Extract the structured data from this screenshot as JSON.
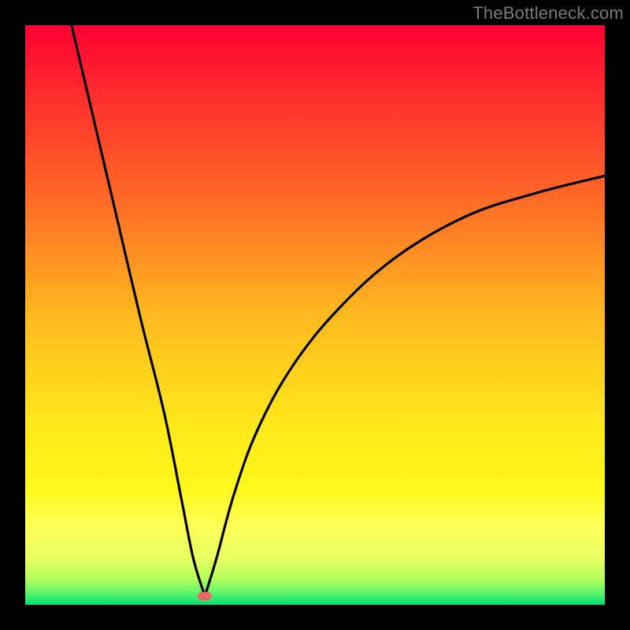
{
  "watermark": "TheBottleneck.com",
  "colors": {
    "frame_border": "#000000",
    "marker": "#e96a63",
    "curve_stroke": "#000000"
  },
  "gradient": {
    "stops": [
      {
        "pct": 0,
        "color": "#ff0033"
      },
      {
        "pct": 12,
        "color": "#ff2d2d"
      },
      {
        "pct": 30,
        "color": "#ff6a26"
      },
      {
        "pct": 50,
        "color": "#ffb91f"
      },
      {
        "pct": 68,
        "color": "#ffe61a"
      },
      {
        "pct": 80,
        "color": "#fff81a"
      },
      {
        "pct": 86.5,
        "color": "#feff57"
      },
      {
        "pct": 92,
        "color": "#e7ff60"
      },
      {
        "pct": 95.5,
        "color": "#b3ff5e"
      },
      {
        "pct": 97.5,
        "color": "#70f768"
      },
      {
        "pct": 100,
        "color": "#00e173"
      }
    ]
  },
  "chart_data": {
    "type": "line",
    "title": "",
    "xlabel": "",
    "ylabel": "",
    "xlim": [
      0,
      100
    ],
    "ylim": [
      0,
      100
    ],
    "note": "V-shaped bottleneck curve; minimum near x≈31. Left branch descends almost linearly from top-left corner to minimum; right branch rises with decreasing slope toward upper-right.",
    "minimum_x": 31,
    "minimum_y": 1.5,
    "left_branch_start": {
      "x": 8,
      "y": 100
    },
    "right_branch_end": {
      "x": 100,
      "y": 74
    },
    "series": [
      {
        "name": "bottleneck-curve",
        "points": [
          {
            "x": 8,
            "y": 100
          },
          {
            "x": 12,
            "y": 83
          },
          {
            "x": 16,
            "y": 66
          },
          {
            "x": 20,
            "y": 49
          },
          {
            "x": 24,
            "y": 33
          },
          {
            "x": 27,
            "y": 18
          },
          {
            "x": 29,
            "y": 8
          },
          {
            "x": 31,
            "y": 1.5
          },
          {
            "x": 33,
            "y": 8
          },
          {
            "x": 36,
            "y": 19
          },
          {
            "x": 40,
            "y": 30
          },
          {
            "x": 46,
            "y": 41
          },
          {
            "x": 54,
            "y": 51
          },
          {
            "x": 64,
            "y": 60
          },
          {
            "x": 76,
            "y": 67
          },
          {
            "x": 88,
            "y": 71
          },
          {
            "x": 100,
            "y": 74
          }
        ]
      }
    ],
    "marker": {
      "x": 31,
      "y": 1.5
    }
  }
}
